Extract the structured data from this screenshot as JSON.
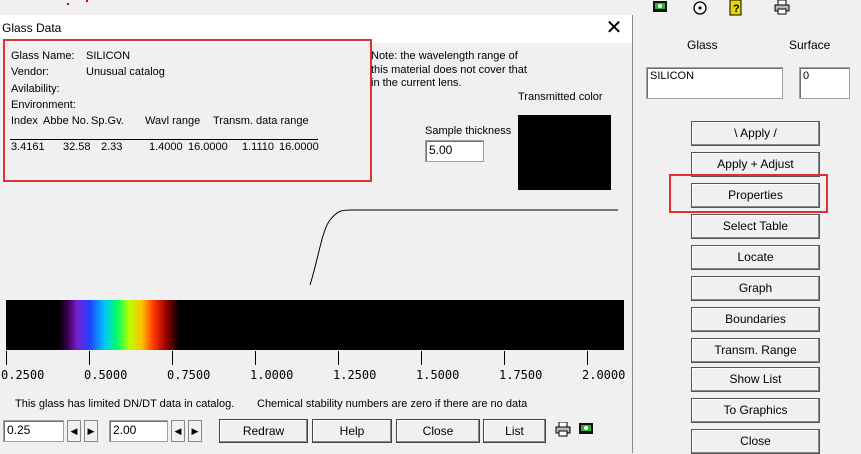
{
  "dialog": {
    "title": "Glass Data",
    "close_glyph": "✕",
    "info": {
      "glass_name_label": "Glass Name:",
      "glass_name_value": "SILICON",
      "vendor_label": "Vendor:",
      "vendor_value": "Unusual catalog",
      "availability_label": "Avilability:",
      "environment_label": "Environment:",
      "headers": [
        "Index",
        "Abbe No.",
        "Sp.Gv.",
        "Wavl range",
        "Transm. data range"
      ],
      "values": [
        "3.4161",
        "32.58",
        "2.33",
        "1.4000",
        "16.0000",
        "1.1110",
        "16.0000"
      ]
    },
    "note": [
      "Note: the wavelength range of",
      "this material does not cover that",
      "in the current lens."
    ],
    "transmitted_color_label": "Transmitted color",
    "sample_thickness_label": "Sample thickness",
    "sample_thickness_value": "5.00",
    "spectrum_ticks": [
      "0.2500",
      "0.5000",
      "0.7500",
      "1.0000",
      "1.2500",
      "1.5000",
      "1.7500",
      "2.0000"
    ],
    "dndt_note": "This glass has limited DN/DT data in catalog.",
    "stability_note": "Chemical stability numbers are zero if there are no data",
    "range_min": "0.25",
    "range_max": "2.00",
    "buttons": {
      "redraw": "Redraw",
      "help": "Help",
      "close": "Close",
      "list": "List"
    },
    "transmitted_color": "#000000",
    "highlight_color": "#e03030"
  },
  "panel": {
    "glass_label": "Glass",
    "surface_label": "Surface",
    "glass_value": "SILICON",
    "surface_value": "0",
    "buttons": [
      "\\  Apply  /",
      "Apply + Adjust",
      "Properties",
      "Select Table",
      "Locate",
      "Graph",
      "Boundaries",
      "Transm. Range",
      "Show List",
      "To Graphics",
      "Close"
    ]
  }
}
